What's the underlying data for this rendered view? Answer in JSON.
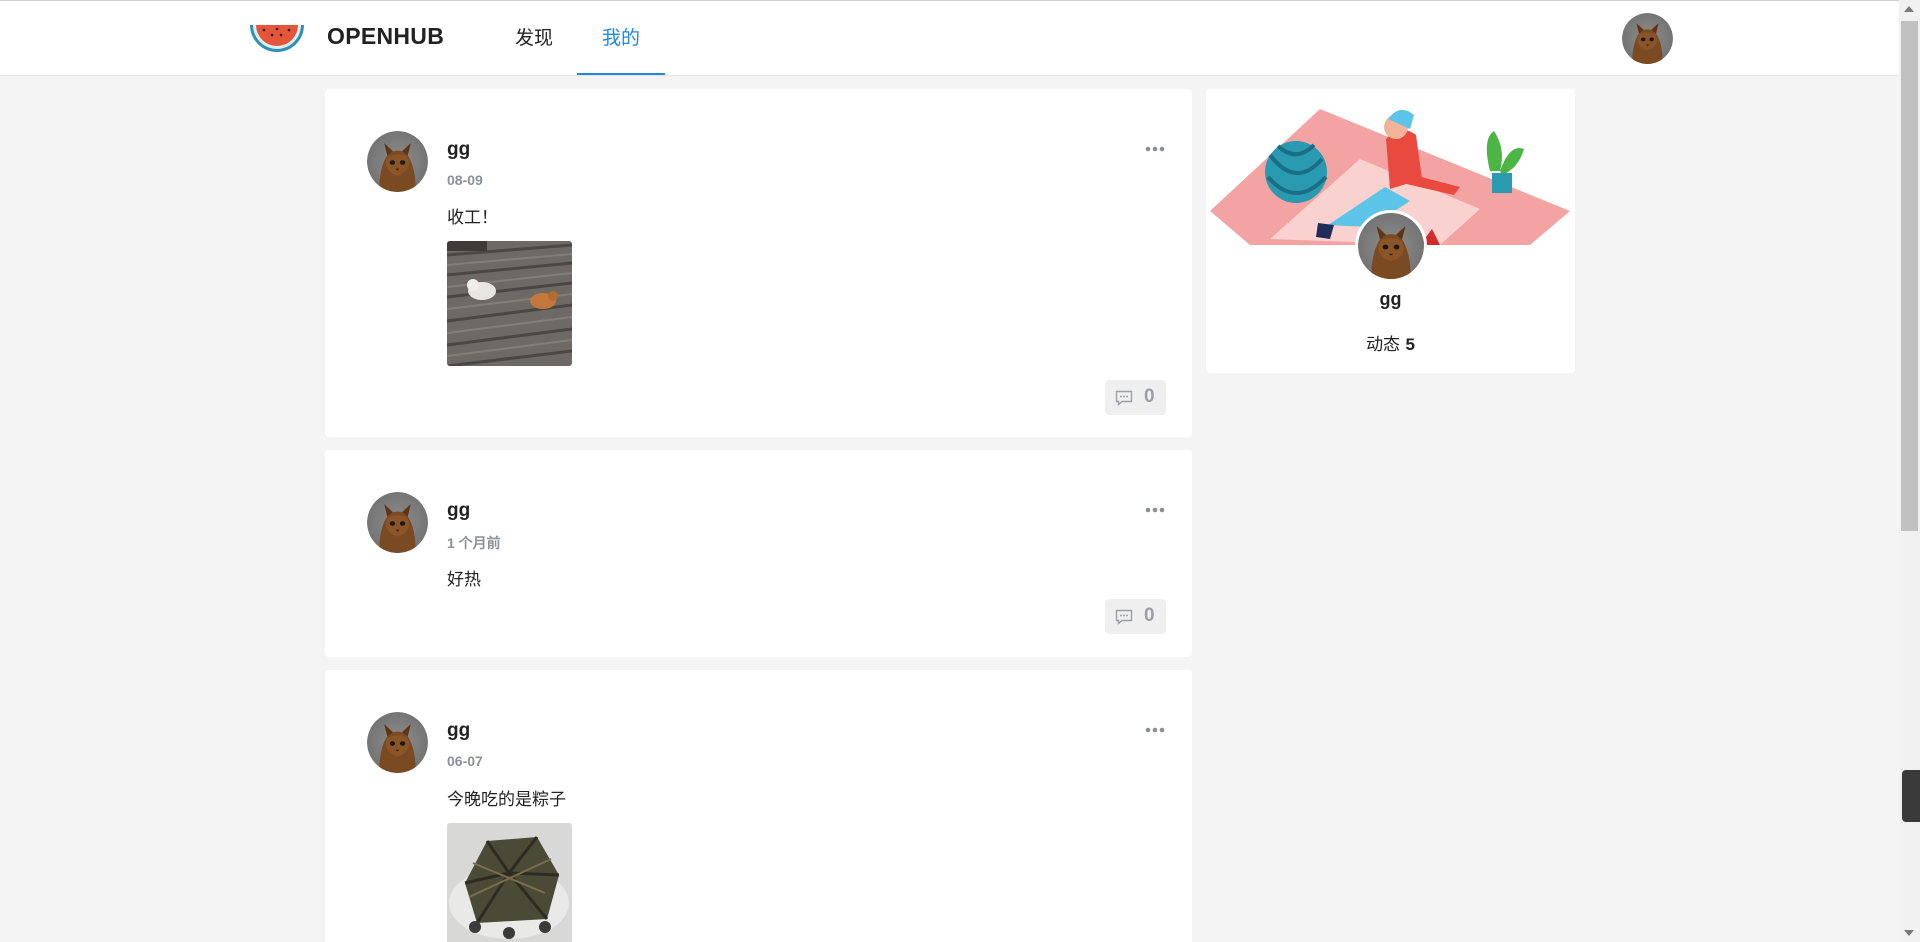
{
  "app": {
    "brand": "OPENHUB",
    "nav": [
      {
        "label": "发现",
        "active": false
      },
      {
        "label": "我的",
        "active": true
      }
    ],
    "accent_color": "#1e88e5"
  },
  "profile": {
    "name": "gg",
    "stats_label": "动态",
    "stats_count": "5"
  },
  "posts": [
    {
      "user": "gg",
      "time": "08-09",
      "text": "收工！",
      "image": "cats-on-roof",
      "comments": "0"
    },
    {
      "user": "gg",
      "time": "1 个月前",
      "text": "好热",
      "image": null,
      "comments": "0"
    },
    {
      "user": "gg",
      "time": "06-07",
      "text": "今晚吃的是粽子",
      "image": "zongzi",
      "comments": null
    }
  ],
  "icons": {
    "logo": "watermelon-logo",
    "more": "more-dots-icon",
    "comment": "comment-icon"
  }
}
